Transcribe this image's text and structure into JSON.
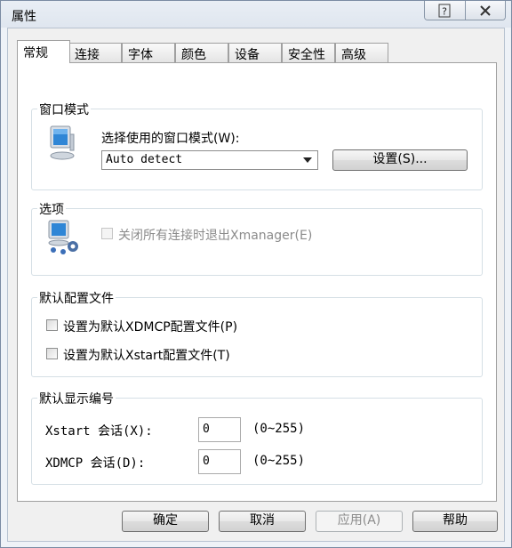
{
  "window": {
    "title": "属性"
  },
  "titlebar": {
    "help_icon": "question-mark-icon",
    "close_icon": "close-x-icon"
  },
  "tabs": [
    {
      "label": "常规",
      "active": true
    },
    {
      "label": "连接"
    },
    {
      "label": "字体"
    },
    {
      "label": "颜色"
    },
    {
      "label": "设备"
    },
    {
      "label": "安全性"
    },
    {
      "label": "高级"
    }
  ],
  "window_mode": {
    "title": "窗口模式",
    "icon": "monitor-icon",
    "label": "选择使用的窗口模式(W):",
    "select_value": "Auto detect",
    "settings_button": "设置(S)..."
  },
  "options": {
    "title": "选项",
    "icon": "network-monitor-icon",
    "exit_checkbox_label": "关闭所有连接时退出Xmanager(E)",
    "exit_checkbox_checked": false
  },
  "default_profiles": {
    "title": "默认配置文件",
    "xdmcp_label": "设置为默认XDMCP配置文件(P)",
    "xdmcp_checked": false,
    "xstart_label": "设置为默认Xstart配置文件(T)",
    "xstart_checked": false
  },
  "display_number": {
    "title": "默认显示编号",
    "xstart_label": "Xstart 会话(X):",
    "xstart_value": "0",
    "xstart_range": "(0~255)",
    "xdmcp_label": "XDMCP 会话(D):",
    "xdmcp_value": "0",
    "xdmcp_range": "(0~255)"
  },
  "footer": {
    "ok": "确定",
    "cancel": "取消",
    "apply": "应用(A)",
    "help": "帮助"
  }
}
